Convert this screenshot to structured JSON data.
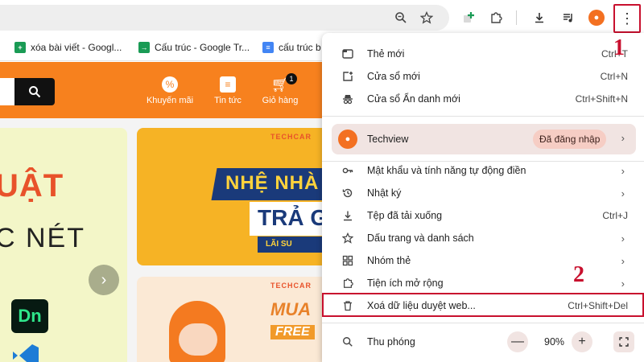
{
  "colors": {
    "brand_orange": "#f7811e",
    "callout_red": "#c8102e",
    "menu_highlight": "#f1e4e2"
  },
  "toolbar": {
    "icons": [
      "zoom-icon",
      "star-icon",
      "extension-add-icon",
      "puzzle-icon",
      "download-icon",
      "media-icon",
      "profile-icon",
      "more-vert-icon"
    ],
    "menu_button_glyph": "⋮",
    "profile_glyph": "●"
  },
  "bookmarks": [
    {
      "label": "xóa bài viết - Googl...",
      "icon": "sheets-icon"
    },
    {
      "label": "Cấu trúc - Google Tr...",
      "icon": "sheets-green-icon"
    },
    {
      "label": "cấu trúc b",
      "icon": "docs-icon"
    }
  ],
  "site": {
    "nav": [
      {
        "label": "Khuyến mãi",
        "icon": "promo-icon"
      },
      {
        "label": "Tin tức",
        "icon": "news-icon"
      },
      {
        "label": "Giỏ hàng",
        "icon": "cart-icon",
        "badge": "1"
      }
    ],
    "banner_left": {
      "line1": "UẬT",
      "line2": "C NÉT",
      "app1": "Dn"
    },
    "banner_top": {
      "brand": "TECHCAR",
      "line1": "NHỆ NHÀ",
      "line2": "TRẢ G",
      "line3": "LÃI SU"
    },
    "banner_bottom": {
      "brand": "TECHCAR",
      "line1": "MUA",
      "line2": "FREE"
    }
  },
  "menu": {
    "group1": [
      {
        "label": "Thẻ mới",
        "shortcut": "Ctrl+T",
        "icon": "new-tab-icon"
      },
      {
        "label": "Cửa sổ mới",
        "shortcut": "Ctrl+N",
        "icon": "new-window-icon"
      },
      {
        "label": "Cửa sổ Ẩn danh mới",
        "shortcut": "Ctrl+Shift+N",
        "icon": "incognito-icon"
      }
    ],
    "profile": {
      "name": "Techview",
      "status": "Đã đăng nhập"
    },
    "group2": [
      {
        "label": "Mật khẩu và tính năng tự động điền",
        "shortcut": "",
        "icon": "key-icon",
        "submenu": true
      },
      {
        "label": "Nhật ký",
        "shortcut": "",
        "icon": "history-icon",
        "submenu": true
      },
      {
        "label": "Tệp đã tải xuống",
        "shortcut": "Ctrl+J",
        "icon": "download-icon",
        "submenu": false
      },
      {
        "label": "Dấu trang và danh sách",
        "shortcut": "",
        "icon": "star-icon",
        "submenu": true
      },
      {
        "label": "Nhóm thẻ",
        "shortcut": "",
        "icon": "tab-groups-icon",
        "submenu": true
      },
      {
        "label": "Tiện ích mở rộng",
        "shortcut": "",
        "icon": "puzzle-icon",
        "submenu": true
      }
    ],
    "clear": {
      "label": "Xoá dữ liệu duyệt web...",
      "shortcut": "Ctrl+Shift+Del",
      "icon": "trash-icon"
    },
    "zoom": {
      "label": "Thu phóng",
      "value": "90%",
      "minus": "—",
      "plus": "+"
    }
  },
  "callouts": {
    "one": "1",
    "two": "2"
  }
}
